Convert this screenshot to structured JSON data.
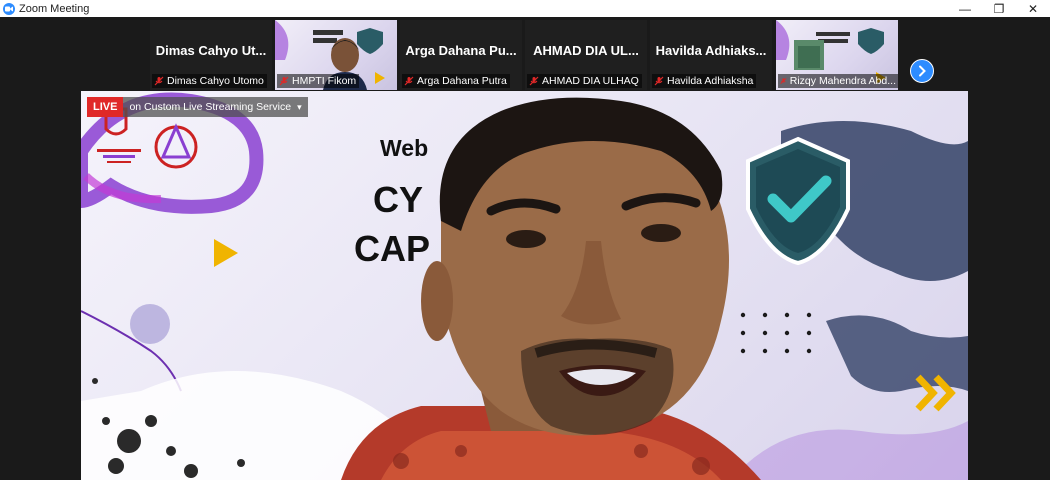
{
  "window": {
    "title": "Zoom Meeting",
    "controls": {
      "minimize": "—",
      "restore": "❐",
      "close": "✕"
    }
  },
  "participants": [
    {
      "name": "Dimas Cahyo Ut...",
      "label": "Dimas Cahyo Utomo",
      "video": false
    },
    {
      "name": "",
      "label": "HMPTI Fikom",
      "video": true
    },
    {
      "name": "Arga Dahana Pu...",
      "label": "Arga Dahana Putra",
      "video": false
    },
    {
      "name": "AHMAD DIA UL...",
      "label": "AHMAD DIA ULHAQ",
      "video": false
    },
    {
      "name": "Havilda  Adhiaks...",
      "label": "Havilda Adhiaksha",
      "video": false
    },
    {
      "name": "",
      "label": "Rizqy Mahendra Abd...",
      "video": true
    }
  ],
  "live": {
    "badge": "LIVE",
    "service": "on Custom Live Streaming Service",
    "caret": "▾"
  },
  "slide": {
    "web": "Web",
    "cy": "CY",
    "cap": "CAP"
  },
  "colors": {
    "accent": "#2d8cff",
    "live": "#e02828",
    "slide_purple": "#8a3fd1",
    "shield": "#2a5c66",
    "arrow": "#f0b400"
  },
  "icons": {
    "app": "zoom-icon",
    "mic": "mic-muted-icon",
    "next": "chevron-right-icon"
  }
}
